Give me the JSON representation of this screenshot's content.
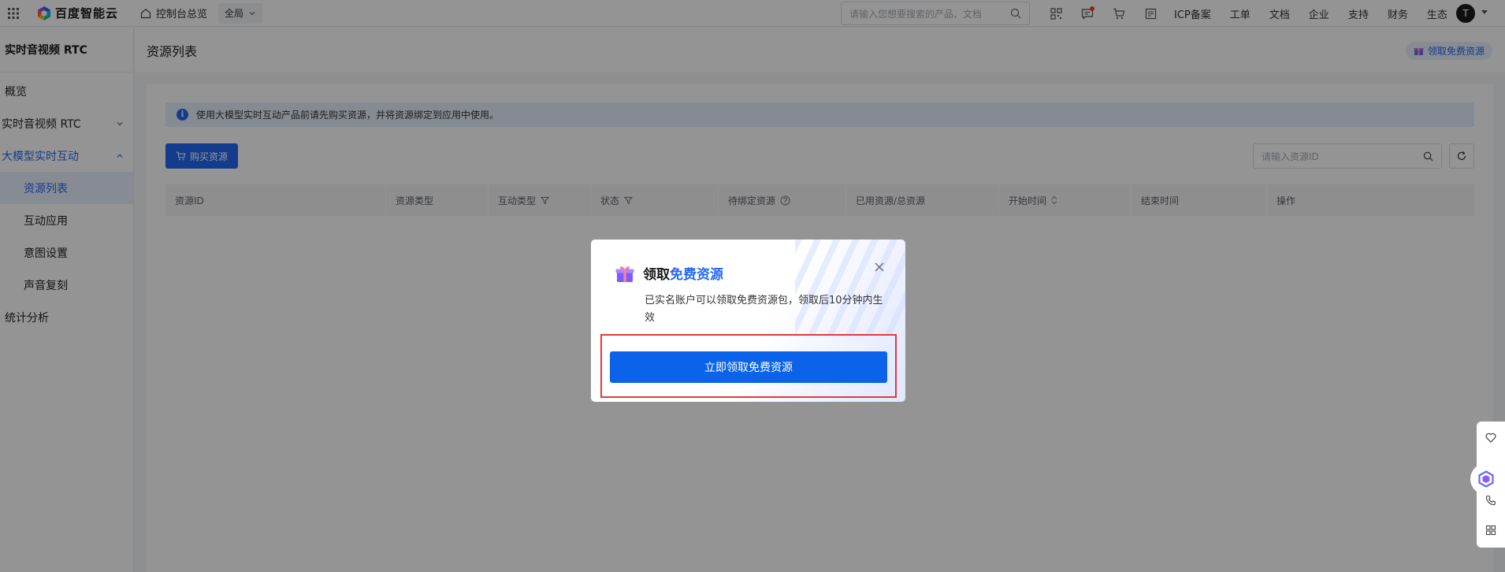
{
  "topbar": {
    "brand": "百度智能云",
    "console_home": "控制台总览",
    "region": "全局",
    "search_placeholder": "请输入您想要搜索的产品、文档",
    "links": [
      "ICP备案",
      "工单",
      "文档",
      "企业",
      "支持",
      "财务",
      "生态"
    ],
    "avatar_initial": "T"
  },
  "sidebar": {
    "title": "实时音视频 RTC",
    "items": [
      {
        "label": "概览"
      },
      {
        "label": "实时音视频 RTC"
      },
      {
        "label": "大模型实时互动"
      },
      {
        "label": "资源列表"
      },
      {
        "label": "互动应用"
      },
      {
        "label": "意图设置"
      },
      {
        "label": "声音复刻"
      },
      {
        "label": "统计分析"
      }
    ]
  },
  "page": {
    "title": "资源列表",
    "free_button": "领取免费资源",
    "notice": "使用大模型实时互动产品前请先购买资源，并将资源绑定到应用中使用。",
    "buy_button": "购买资源",
    "search_placeholder": "请输入资源ID",
    "columns": [
      "资源ID",
      "资源类型",
      "互动类型",
      "状态",
      "待绑定资源",
      "已用资源/总资源",
      "开始时间",
      "结束时间",
      "操作"
    ]
  },
  "modal": {
    "title_prefix": "领取",
    "title_highlight": "免费资源",
    "description": "已实名账户可以领取免费资源包，领取后10分钟内生效",
    "cta": "立即领取免费资源"
  },
  "colors": {
    "primary": "#2468f2",
    "cta": "#0b63ea",
    "highlight_border": "#e53935"
  }
}
